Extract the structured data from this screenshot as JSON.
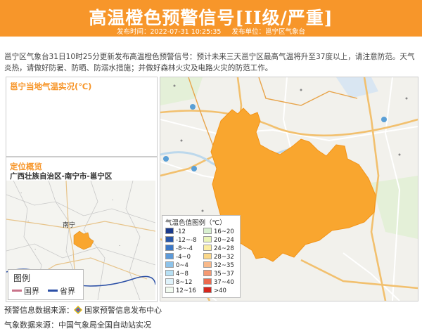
{
  "header": {
    "title": "高温橙色预警信号[II级/严重]",
    "publish_time_label": "发布时间：2022-07-31 10:25:35",
    "publish_unit_label": "发布单位：邕宁区气象台",
    "bg_color": "#f7962a"
  },
  "description": "邕宁区气象台31日10时25分更新发布高温橙色预警信号：预计未来三天邕宁区最高气温将升至37度以上，请注意防范。天气炎热，请做好防暑、防晒、防溺水措施；并做好森林火灾及电路火灾的防范工作。",
  "temp_panel": {
    "title": "邕宁当地气温实况(℃)"
  },
  "locate_panel": {
    "title": "定位概览",
    "region": "广西壮族自治区-南宁市-邕宁区",
    "city_label": "南宁",
    "legend_title": "图例",
    "legend_items": [
      {
        "label": "国界",
        "color": "#c9738a"
      },
      {
        "label": "省界",
        "color": "#2b4fa6"
      }
    ]
  },
  "map_legend": {
    "title": "气温色值图例（℃）",
    "items": [
      {
        "label": "-12",
        "color": "#1a3a8c"
      },
      {
        "label": "-12~-8",
        "color": "#2856a8"
      },
      {
        "label": "-8~-4",
        "color": "#3c78c6"
      },
      {
        "label": "-4~0",
        "color": "#5c9ad9"
      },
      {
        "label": "0~4",
        "color": "#8dc3ea"
      },
      {
        "label": "4~8",
        "color": "#b7e0f4"
      },
      {
        "label": "8~12",
        "color": "#dff3fb"
      },
      {
        "label": "12~16",
        "color": "#f2fbf0"
      },
      {
        "label": "16~20",
        "color": "#d8f0d0"
      },
      {
        "label": "20~24",
        "color": "#eaf5b8"
      },
      {
        "label": "24~28",
        "color": "#fbeea4"
      },
      {
        "label": "28~32",
        "color": "#fbd88a"
      },
      {
        "label": "32~35",
        "color": "#f8b98a"
      },
      {
        "label": "35~37",
        "color": "#f59a73"
      },
      {
        "label": "37~40",
        "color": "#ec6a4e"
      },
      {
        "label": ">40",
        "color": "#d7261c"
      }
    ]
  },
  "footer": {
    "warning_source": "预警信息数据来源：",
    "warning_org": "国家预警信息发布中心",
    "weather_source": "气象数据来源：中国气象局全国自动站实况"
  },
  "region_fill": "#f9a62f"
}
